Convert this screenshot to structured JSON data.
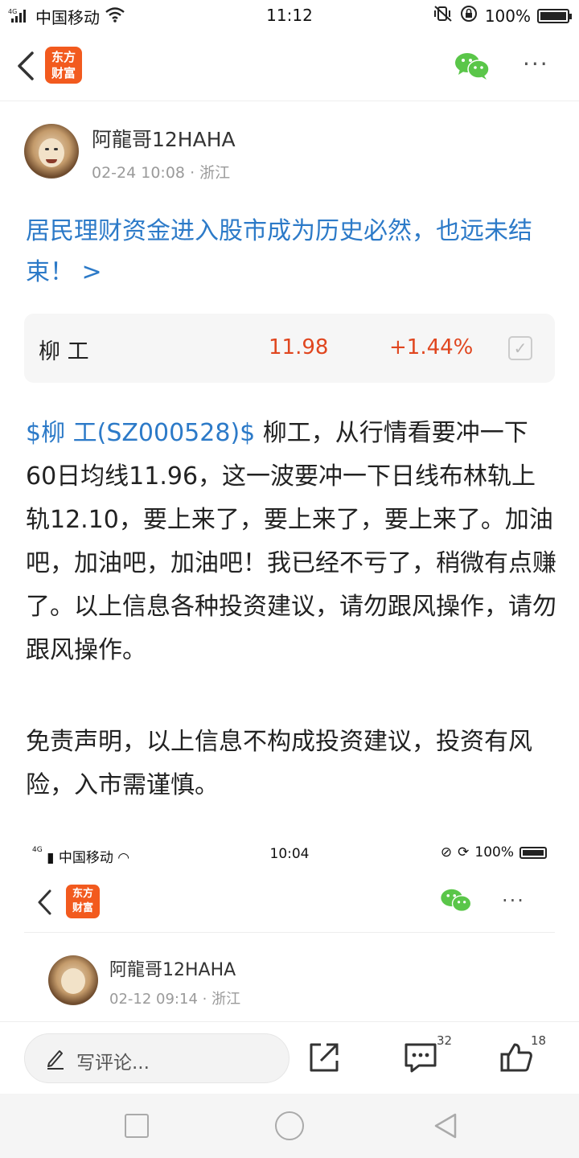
{
  "status_bar": {
    "network": "4G",
    "carrier": "中国移动",
    "time": "11:12",
    "battery": "100%",
    "battery_level": 1.0
  },
  "nav": {
    "logo_line1": "东方",
    "logo_line2": "财富",
    "back_icon": "chevron-left-icon",
    "share_icon": "wechat-icon",
    "more_label": "···"
  },
  "author": {
    "name": "阿龍哥12HAHA",
    "datetime": "02-24 10:08",
    "location": "· 浙江"
  },
  "post": {
    "title": "居民理财资金进入股市成为历史必然，也远未结束！ >",
    "body_tag": "$柳 工(SZ000528)$",
    "body_text": " 柳工，从行情看要冲一下60日均线11.96，这一波要冲一下日线布林轨上轨12.10，要上来了，要上来了，要上来了。加油吧，加油吧，加油吧！我已经不亏了，稍微有点赚了。以上信息各种投资建议，请勿跟风操作，请勿跟风操作。",
    "disclaimer": "免责声明，以上信息不构成投资建议，投资有风险，入市需谨慎。"
  },
  "stock": {
    "name": "柳 工",
    "price": "11.98",
    "change": "+1.44%",
    "change_color": "#e0461f"
  },
  "embedded_screenshot": {
    "network": "4G",
    "carrier": "中国移动",
    "time": "10:04",
    "battery": "100%",
    "logo_line1": "东方",
    "logo_line2": "财富",
    "more_label": "···",
    "author_name": "阿龍哥12HAHA",
    "datetime": "02-12 09:14",
    "location": "· 浙江"
  },
  "action_bar": {
    "comment_placeholder": "写评论...",
    "comment_count": "32",
    "like_count": "18"
  },
  "colors": {
    "accent_link": "#2c7ac8",
    "brand": "#f25a1e",
    "up": "#e0461f",
    "wechat": "#5ac649"
  }
}
